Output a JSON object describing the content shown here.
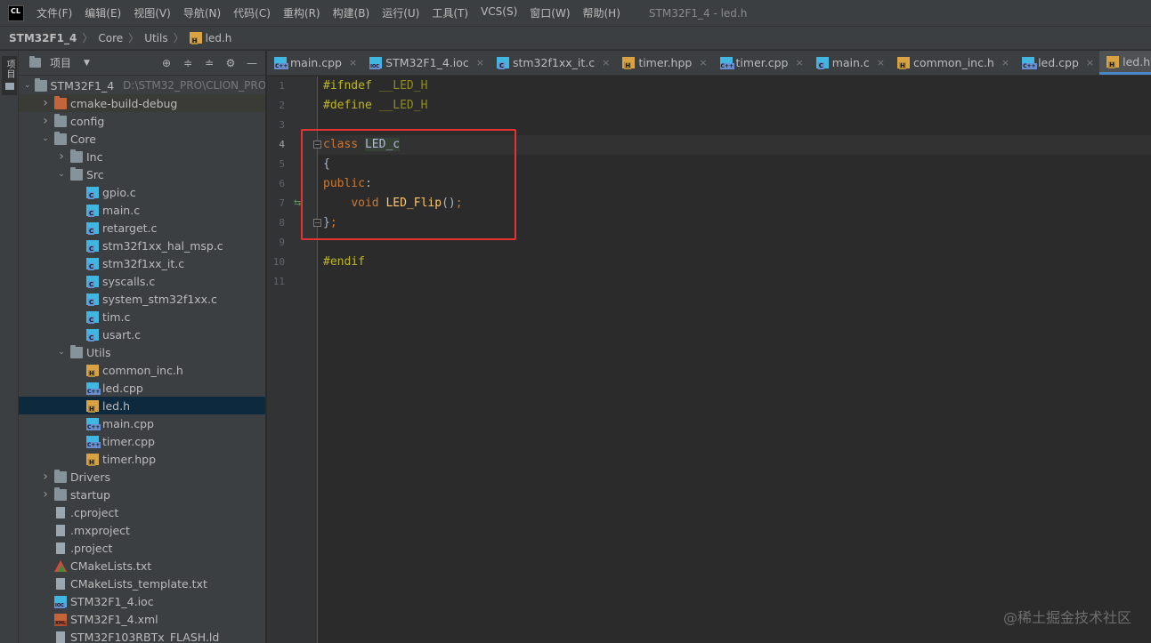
{
  "menubar": {
    "logo": "CL",
    "items": [
      "文件(F)",
      "编辑(E)",
      "视图(V)",
      "导航(N)",
      "代码(C)",
      "重构(R)",
      "构建(B)",
      "运行(U)",
      "工具(T)",
      "VCS(S)",
      "窗口(W)",
      "帮助(H)"
    ],
    "window_title": "STM32F1_4 - led.h"
  },
  "breadcrumb": [
    "STM32F1_4",
    "Core",
    "Utils",
    "led.h"
  ],
  "left_strip": {
    "tab_label": "项目"
  },
  "project_panel": {
    "title": "项目",
    "tree": [
      {
        "label": "STM32F1_4",
        "hint": "D:\\STM32_PRO\\CLION_PRO",
        "indent": 0,
        "arrow": "down",
        "icon": "folder"
      },
      {
        "label": "cmake-build-debug",
        "indent": 1,
        "arrow": "right",
        "icon": "folder-orange",
        "excluded": true
      },
      {
        "label": "config",
        "indent": 1,
        "arrow": "right",
        "icon": "folder"
      },
      {
        "label": "Core",
        "indent": 1,
        "arrow": "down",
        "icon": "folder"
      },
      {
        "label": "Inc",
        "indent": 2,
        "arrow": "right",
        "icon": "folder"
      },
      {
        "label": "Src",
        "indent": 2,
        "arrow": "down",
        "icon": "folder"
      },
      {
        "label": "gpio.c",
        "indent": 3,
        "icon": "c"
      },
      {
        "label": "main.c",
        "indent": 3,
        "icon": "c"
      },
      {
        "label": "retarget.c",
        "indent": 3,
        "icon": "c"
      },
      {
        "label": "stm32f1xx_hal_msp.c",
        "indent": 3,
        "icon": "c"
      },
      {
        "label": "stm32f1xx_it.c",
        "indent": 3,
        "icon": "c"
      },
      {
        "label": "syscalls.c",
        "indent": 3,
        "icon": "c"
      },
      {
        "label": "system_stm32f1xx.c",
        "indent": 3,
        "icon": "c"
      },
      {
        "label": "tim.c",
        "indent": 3,
        "icon": "c"
      },
      {
        "label": "usart.c",
        "indent": 3,
        "icon": "c"
      },
      {
        "label": "Utils",
        "indent": 2,
        "arrow": "down",
        "icon": "folder"
      },
      {
        "label": "common_inc.h",
        "indent": 3,
        "icon": "h"
      },
      {
        "label": "led.cpp",
        "indent": 3,
        "icon": "cpp"
      },
      {
        "label": "led.h",
        "indent": 3,
        "icon": "h",
        "selected": true
      },
      {
        "label": "main.cpp",
        "indent": 3,
        "icon": "cpp"
      },
      {
        "label": "timer.cpp",
        "indent": 3,
        "icon": "cpp"
      },
      {
        "label": "timer.hpp",
        "indent": 3,
        "icon": "h"
      },
      {
        "label": "Drivers",
        "indent": 1,
        "arrow": "right",
        "icon": "folder"
      },
      {
        "label": "startup",
        "indent": 1,
        "arrow": "right",
        "icon": "folder"
      },
      {
        "label": ".cproject",
        "indent": 1,
        "icon": "text"
      },
      {
        "label": ".mxproject",
        "indent": 1,
        "icon": "text"
      },
      {
        "label": ".project",
        "indent": 1,
        "icon": "text"
      },
      {
        "label": "CMakeLists.txt",
        "indent": 1,
        "icon": "cmake"
      },
      {
        "label": "CMakeLists_template.txt",
        "indent": 1,
        "icon": "text"
      },
      {
        "label": "STM32F1_4.ioc",
        "indent": 1,
        "icon": "ioc"
      },
      {
        "label": "STM32F1_4.xml",
        "indent": 1,
        "icon": "xml"
      },
      {
        "label": "STM32F103RBTx_FLASH.ld",
        "indent": 1,
        "icon": "ld"
      }
    ]
  },
  "tabs": [
    {
      "label": "main.cpp",
      "icon": "cpp"
    },
    {
      "label": "STM32F1_4.ioc",
      "icon": "ioc"
    },
    {
      "label": "stm32f1xx_it.c",
      "icon": "c"
    },
    {
      "label": "timer.hpp",
      "icon": "h"
    },
    {
      "label": "timer.cpp",
      "icon": "cpp"
    },
    {
      "label": "main.c",
      "icon": "c"
    },
    {
      "label": "common_inc.h",
      "icon": "h"
    },
    {
      "label": "led.cpp",
      "icon": "cpp"
    },
    {
      "label": "led.h",
      "icon": "h",
      "active": true
    }
  ],
  "editor": {
    "line_numbers": [
      "1",
      "2",
      "3",
      "4",
      "5",
      "6",
      "7",
      "8",
      "9",
      "10",
      "11"
    ],
    "current_line": 4,
    "code": {
      "l1_kw": "#ifndef",
      "l1_macro": "__LED_H",
      "l2_kw": "#define",
      "l2_macro": "__LED_H",
      "l4_kw": "class",
      "l4_name": "LED_c",
      "l5": "{",
      "l6_kw": "public",
      "l6_colon": ":",
      "l7_indent": "    ",
      "l7_kw": "void",
      "l7_fn": "LED_Flip",
      "l7_rest": "()",
      "l7_semi": ";",
      "l8_brace": "}",
      "l8_semi": ";",
      "l10_kw": "#endif"
    }
  },
  "watermark": "@稀土掘金技术社区",
  "colors": {
    "highlight_border": "#e53232",
    "selection": "#0d293e",
    "tab_underline": "#4a88c7"
  }
}
